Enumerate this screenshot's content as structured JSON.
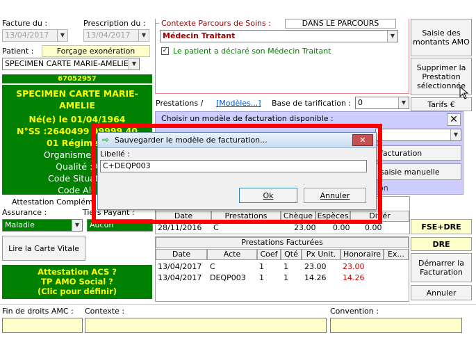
{
  "header": {
    "facture_label": "Facture du :",
    "facture_date": "13/04/2017",
    "prescription_label": "Prescription du :",
    "prescription_date": "13/04/2017",
    "patient_label": "Patient :",
    "forcage_button": "Forçage exonération",
    "patient_name": "SPECIMEN CARTE MARIE-AMELIE"
  },
  "patient_card": {
    "id": "67052957",
    "name": "SPECIMEN CARTE MARIE-AMELIE",
    "born": "Né(e) le 01/04/1964",
    "nss": "N°SS :2640499 99999 40",
    "regime": "01 Régime g",
    "organisme": "Organisme :01.",
    "qualite": "Qualité :A",
    "code_situation": "Code Situatio",
    "code_alo": "Code Alo"
  },
  "attestation": {
    "label": "Attestation Complém",
    "assurance_label": "Assurance :",
    "tiers_label": "Tiers Payant :",
    "assurance_value": "Maladie",
    "tiers_value": "Aucun",
    "lire_button": "Lire la Carte Vitale",
    "acs_lines": [
      "Attestation ACS ?",
      "TP AMO Social ?",
      "(Clic pour définir)"
    ]
  },
  "parcours": {
    "title": "Contexte Parcours de Soins  :",
    "status": "DANS LE PARCOURS",
    "medecin": "Médecin Traitant",
    "declared": "Le patient a déclaré son Médecin Traitant"
  },
  "right_buttons": {
    "saisie": "Saisie des montants AMO",
    "supprimer": "Supprimer la Prestation sélectionnée",
    "tarifs": "Tarifs €",
    "fse": "FSE+DRE",
    "dre": "DRE",
    "demarrer": "Démarrer la Facturation",
    "annuler": "Annuler"
  },
  "prestations_bar": {
    "label": "Prestations /",
    "modeles": "[Modèles...]",
    "base_label": "Base de tarification :",
    "base_value": "0"
  },
  "model_panel": {
    "title": "Choisir un modèle de facturation disponible :",
    "facturation_btn": "facturation",
    "saisie_btn": "saisie manuelle",
    "partial": "on"
  },
  "dialog": {
    "title": "Sauvegarder le modèle de facturation...",
    "libelle_label": "Libellé :",
    "libelle_value": "C+DEQP003",
    "ok": "Ok",
    "annuler": "Annuler"
  },
  "history_table": {
    "columns": [
      "Date",
      "Prestations",
      "Chèque",
      "Espèces",
      "Différ"
    ],
    "rows": [
      [
        "28/11/2016",
        "C",
        "23.00",
        "0.00",
        "0.00"
      ]
    ]
  },
  "billed_table": {
    "title": "Prestations Facturées",
    "columns": [
      "Date",
      "Acte",
      "Coef",
      "Qté",
      "Px Unit.",
      "Honoraire",
      "Ex..."
    ],
    "rows": [
      [
        "13/04/2017",
        "C",
        "1",
        "1",
        "23.00",
        "23.00"
      ],
      [
        "13/04/2017",
        "DEQP003",
        "1",
        "1",
        "14.26",
        "14.26"
      ]
    ]
  },
  "footer": {
    "fin_droits": "Fin de droits AMC :",
    "contexte": "Contexte :",
    "convention": "Convention :"
  },
  "colors": {
    "green": "#008000",
    "yellow_text": "#ffff00",
    "highlight_red": "#ff0000",
    "panel_lavender": "#ccccff"
  }
}
